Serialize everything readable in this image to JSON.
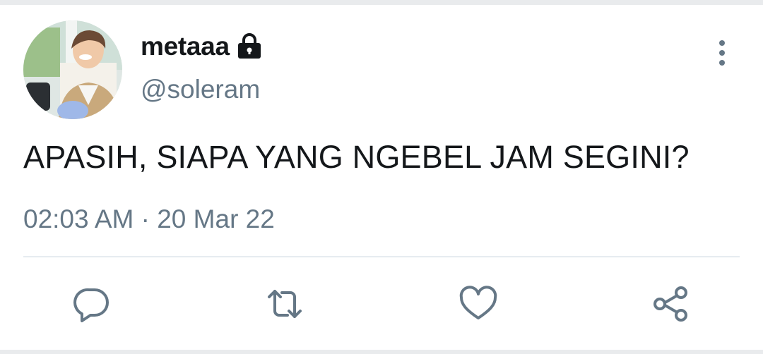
{
  "tweet": {
    "display_name": "metaaa",
    "handle": "@soleram",
    "text": "APASIH, SIAPA YANG NGEBEL JAM SEGINI?",
    "time": "02:03 AM",
    "separator": "·",
    "date": "20 Mar 22",
    "protected_icon": "lock-icon",
    "menu_icon": "more-vertical-icon"
  },
  "actions": [
    {
      "icon": "reply-icon"
    },
    {
      "icon": "retweet-icon"
    },
    {
      "icon": "like-icon"
    },
    {
      "icon": "share-icon"
    }
  ],
  "colors": {
    "text_primary": "#14171a",
    "text_secondary": "#657786",
    "icon": "#657786",
    "divider": "#e6ecf0"
  }
}
